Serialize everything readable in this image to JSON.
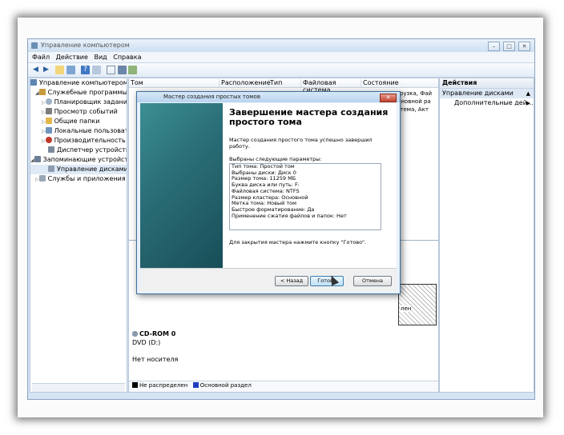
{
  "window": {
    "title": "Управление компьютером",
    "min_btn": "–",
    "max_btn": "□",
    "close_btn": "✕"
  },
  "menu": [
    "Файл",
    "Действие",
    "Вид",
    "Справка"
  ],
  "tree": {
    "items": [
      {
        "label": "Управление компьютером (л"
      },
      {
        "label": "Служебные программы"
      },
      {
        "label": "Планировщик задани"
      },
      {
        "label": "Просмотр событий"
      },
      {
        "label": "Общие папки"
      },
      {
        "label": "Локальные пользовате"
      },
      {
        "label": "Производительность"
      },
      {
        "label": "Диспетчер устройств"
      },
      {
        "label": "Запоминающие устройст"
      },
      {
        "label": "Управление дисками"
      },
      {
        "label": "Службы и приложения"
      }
    ]
  },
  "volumes": {
    "columns": [
      "Том",
      "Расположение",
      "Тип",
      "Файловая система",
      "Состояние"
    ],
    "partial_text": [
      "агрузка, Фай",
      "Основной ра",
      "истема, Акт"
    ]
  },
  "disks": {
    "cdrom_name": "CD-ROM 0",
    "cdrom_type": "DVD (D:)",
    "cdrom_status": "Нет носителя",
    "partial_label": "лен"
  },
  "legend": {
    "unallocated": "Не распределен",
    "primary": "Основной раздел",
    "unallocated_color": "#000000",
    "primary_color": "#1f3fbf"
  },
  "actions": {
    "header": "Действия",
    "section": "Управление дисками",
    "item": "Дополнительные дей..."
  },
  "wizard": {
    "title": "Мастер создания простых томов",
    "heading": "Завершение мастера создания простого тома",
    "text1": "Мастер создания простого тома успешно завершил работу.",
    "params_label": "Выбраны следующие параметры:",
    "params": [
      "Тип тома: Простой том",
      "Выбраны диски: Диск 0",
      "Размер тома: 11259 МБ",
      "Буква диска или путь: F:",
      "Файловая система: NTFS",
      "Размер кластера: Основной",
      "Метка тома: Новый том",
      "Быстрое форматирование: Да",
      "Применение сжатия файлов и папок: Нет"
    ],
    "text2": "Для закрытия мастера нажмите кнопку \"Готово\".",
    "back": "< Назад",
    "finish": "Готово",
    "cancel": "Отмена",
    "close_btn": "✕"
  }
}
